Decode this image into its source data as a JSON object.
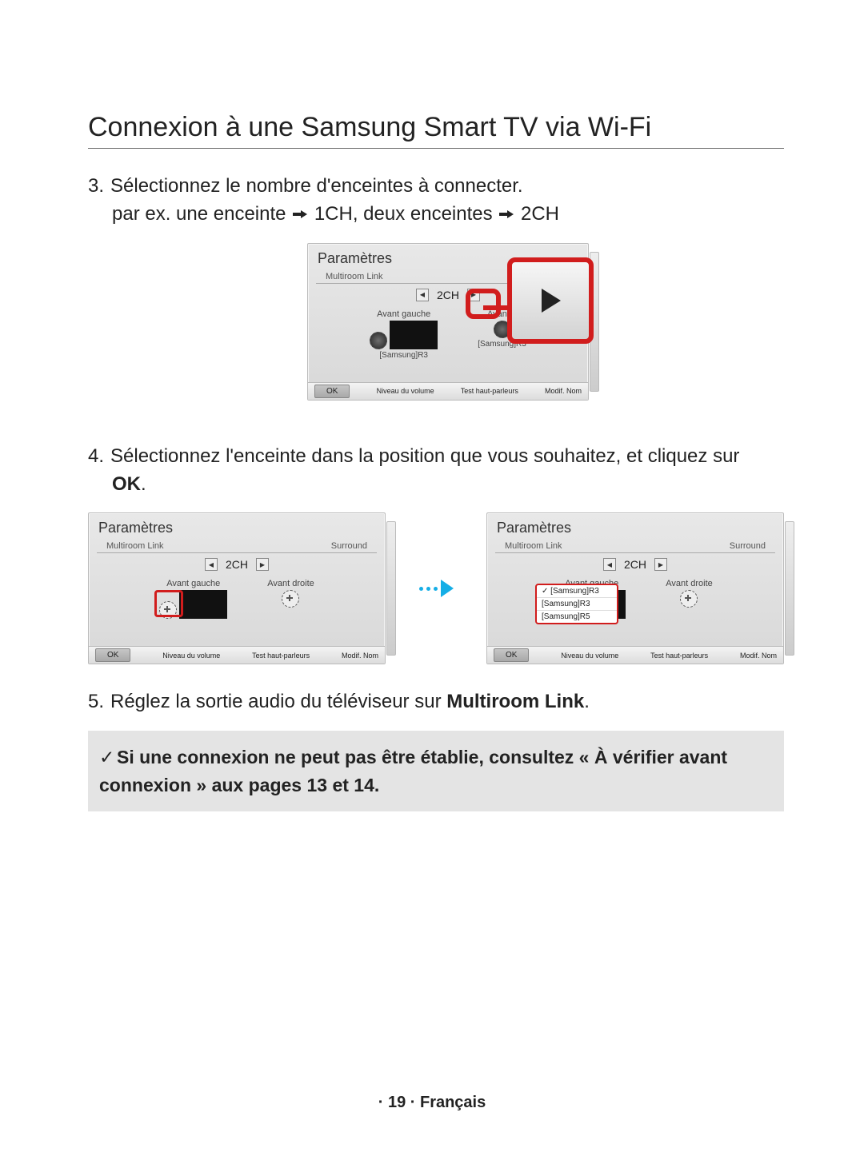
{
  "title": "Connexion à une Samsung Smart TV via Wi-Fi",
  "step3": {
    "num": "3.",
    "line1": "Sélectionnez le nombre d'enceintes à connecter.",
    "line2a": "par ex. une enceinte ",
    "line2b": " 1CH, deux enceintes ",
    "line2c": " 2CH"
  },
  "step4": {
    "num": "4.",
    "text_a": "Sélectionnez l'enceinte dans la position que vous souhaitez, et cliquez sur ",
    "ok": "OK",
    "period": "."
  },
  "step5": {
    "num": "5.",
    "text_a": "Réglez la sortie audio du téléviseur sur ",
    "bold": "Multiroom Link",
    "period": "."
  },
  "note": {
    "tick": "✓",
    "text": "Si une connexion ne peut pas être établie, consultez « À vérifier avant connexion » aux pages 13 et 14."
  },
  "footer": "· 19 · Français",
  "panel": {
    "title": "Paramètres",
    "sub_left": "Multiroom Link",
    "sub_right": "Surround",
    "ch": "2CH",
    "front_left": "Avant gauche",
    "front_right": "Avant droite",
    "front_right_cut": "Avant d",
    "speaker_name": "[Samsung]R3",
    "ok": "OK",
    "bottom_items": [
      "Niveau du volume",
      "Test haut-parleurs",
      "Modif. Nom"
    ]
  },
  "dropdown": {
    "opt1": "[Samsung]R3",
    "opt2": "[Samsung]R3",
    "opt3": "[Samsung]R5"
  }
}
